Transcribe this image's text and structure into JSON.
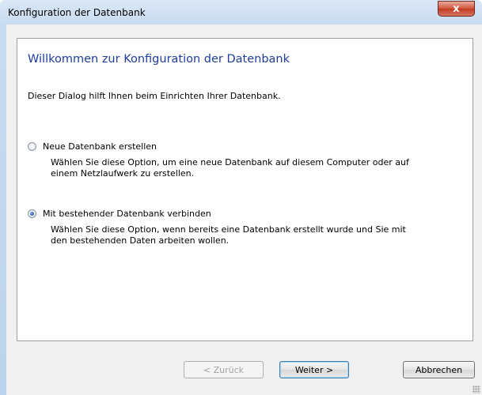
{
  "window": {
    "title": "Konfiguration der Datenbank",
    "close_glyph": "x"
  },
  "panel": {
    "heading": "Willkommen zur Konfiguration der Datenbank",
    "intro": "Dieser Dialog hilft Ihnen beim Einrichten Ihrer Datenbank."
  },
  "options": [
    {
      "label": "Neue Datenbank erstellen",
      "description": "Wählen Sie diese Option, um eine neue Datenbank auf diesem Computer oder auf einem Netzlaufwerk zu erstellen.",
      "selected": false
    },
    {
      "label": "Mit bestehender Datenbank verbinden",
      "description": "Wählen Sie diese Option, wenn bereits eine Datenbank erstellt wurde und Sie mit den bestehenden Daten arbeiten wollen.",
      "selected": true
    }
  ],
  "buttons": {
    "back": "< Zurück",
    "next": "Weiter >",
    "cancel": "Abbrechen"
  },
  "colors": {
    "heading": "#1e3d9c",
    "close_button": "#c23a20"
  }
}
